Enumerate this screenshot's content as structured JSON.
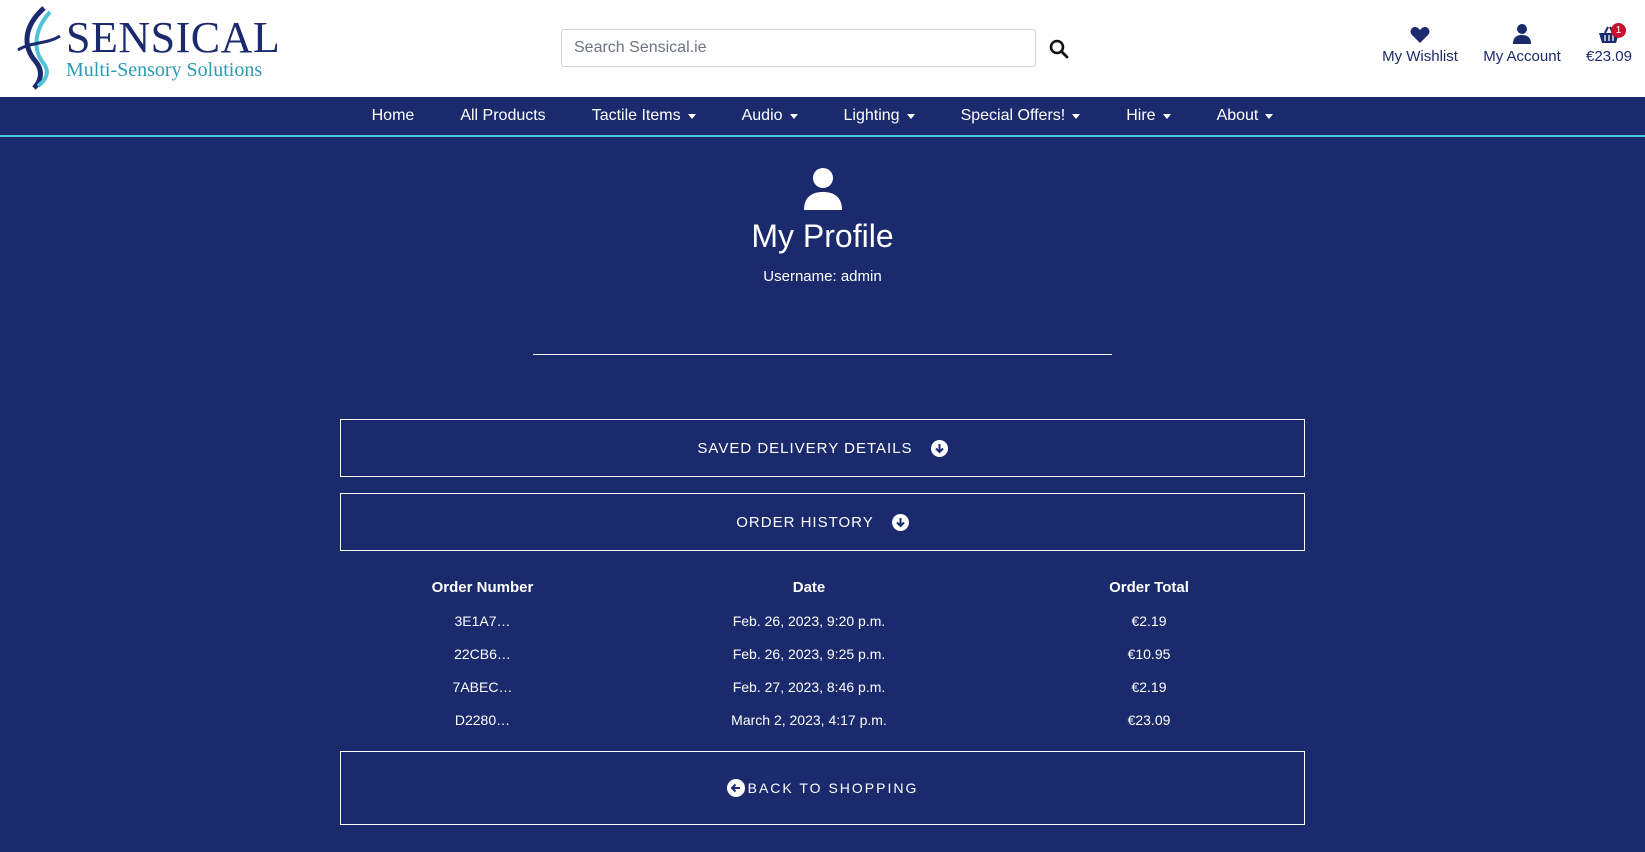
{
  "header": {
    "logo": {
      "title": "SENSICAL",
      "subtitle": "Multi-Sensory Solutions"
    },
    "search": {
      "placeholder": "Search Sensical.ie",
      "value": ""
    },
    "links": {
      "wishlist": "My Wishlist",
      "account": "My Account",
      "basket_total": "€23.09",
      "basket_count": "1"
    }
  },
  "nav": {
    "items": [
      {
        "label": "Home",
        "dropdown": false
      },
      {
        "label": "All Products",
        "dropdown": false
      },
      {
        "label": "Tactile Items",
        "dropdown": true
      },
      {
        "label": "Audio",
        "dropdown": true
      },
      {
        "label": "Lighting",
        "dropdown": true
      },
      {
        "label": "Special Offers!",
        "dropdown": true
      },
      {
        "label": "Hire",
        "dropdown": true
      },
      {
        "label": "About",
        "dropdown": true
      }
    ]
  },
  "profile": {
    "title": "My Profile",
    "username": "Username: admin"
  },
  "panels": {
    "delivery": "SAVED DELIVERY DETAILS",
    "history": "ORDER HISTORY",
    "back": "BACK TO SHOPPING"
  },
  "orders": {
    "headers": [
      "Order Number",
      "Date",
      "Order Total"
    ],
    "rows": [
      [
        "3E1A7…",
        "Feb. 26, 2023, 9:20 p.m.",
        "€2.19"
      ],
      [
        "22CB6…",
        "Feb. 26, 2023, 9:25 p.m.",
        "€10.95"
      ],
      [
        "7ABEC…",
        "Feb. 27, 2023, 8:46 p.m.",
        "€2.19"
      ],
      [
        "D2280…",
        "March 2, 2023, 4:17 p.m.",
        "€23.09"
      ]
    ]
  },
  "colors": {
    "brand_navy": "#1a2a6c",
    "accent_teal": "#2b9bb5",
    "nav_underline": "#4fc3d9",
    "badge_red": "#c8102e"
  }
}
